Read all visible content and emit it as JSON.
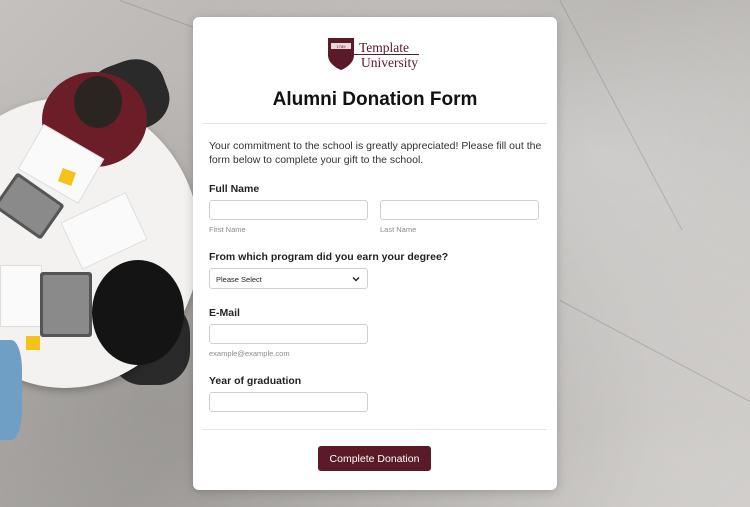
{
  "logo": {
    "line1": "Template",
    "line2": "University",
    "shield_text": "1789"
  },
  "form": {
    "title": "Alumni Donation Form",
    "intro": "Your commitment to the school is greatly appreciated! Please fill out the form below to complete your gift to the school.",
    "full_name": {
      "label": "Full Name",
      "first_sub": "First Name",
      "last_sub": "Last Name",
      "first_value": "",
      "last_value": ""
    },
    "program": {
      "label": "From which program did you earn your degree?",
      "selected": "Please Select"
    },
    "email": {
      "label": "E-Mail",
      "value": "",
      "sub": "example@example.com"
    },
    "graduation": {
      "label": "Year of graduation",
      "value": ""
    },
    "submit_label": "Complete Donation"
  },
  "colors": {
    "brand": "#5a1a26",
    "input_border": "#cfcfd4"
  },
  "icons": {
    "select_arrow": "chevron-down-icon",
    "logo": "shield-icon"
  }
}
